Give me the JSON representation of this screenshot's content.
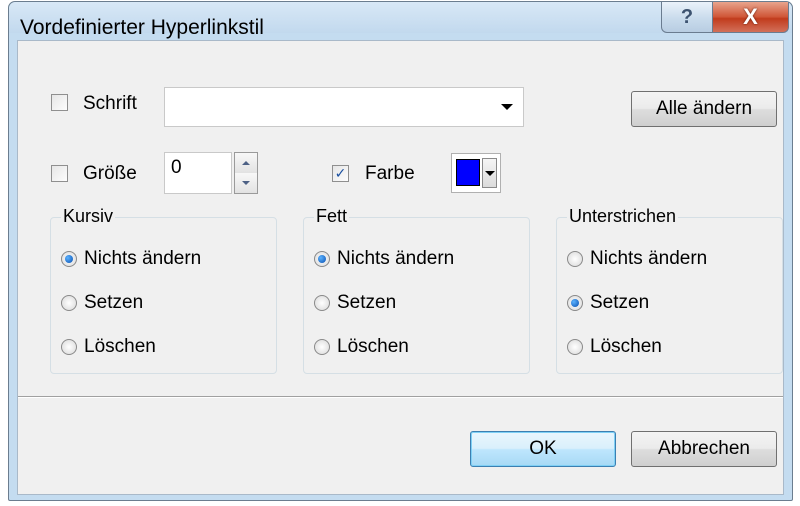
{
  "window": {
    "title": "Vordefinierter Hyperlinkstil",
    "help_glyph": "?",
    "close_glyph": "X"
  },
  "font_row": {
    "checkbox_checked": false,
    "label": "Schrift",
    "value": ""
  },
  "change_all_label": "Alle ändern",
  "size_row": {
    "checkbox_checked": false,
    "label": "Größe",
    "value": "0"
  },
  "color_row": {
    "checkbox_checked": true,
    "check_glyph": "✓",
    "label": "Farbe",
    "color": "#0000ff"
  },
  "groups": [
    {
      "name": "italic",
      "label": "Kursiv",
      "options": [
        "Nichts ändern",
        "Setzen",
        "Löschen"
      ],
      "selected_index": 0
    },
    {
      "name": "bold",
      "label": "Fett",
      "options": [
        "Nichts ändern",
        "Setzen",
        "Löschen"
      ],
      "selected_index": 0
    },
    {
      "name": "underline",
      "label": "Unterstrichen",
      "options": [
        "Nichts ändern",
        "Setzen",
        "Löschen"
      ],
      "selected_index": 1
    }
  ],
  "buttons": {
    "ok": "OK",
    "cancel": "Abbrechen"
  }
}
